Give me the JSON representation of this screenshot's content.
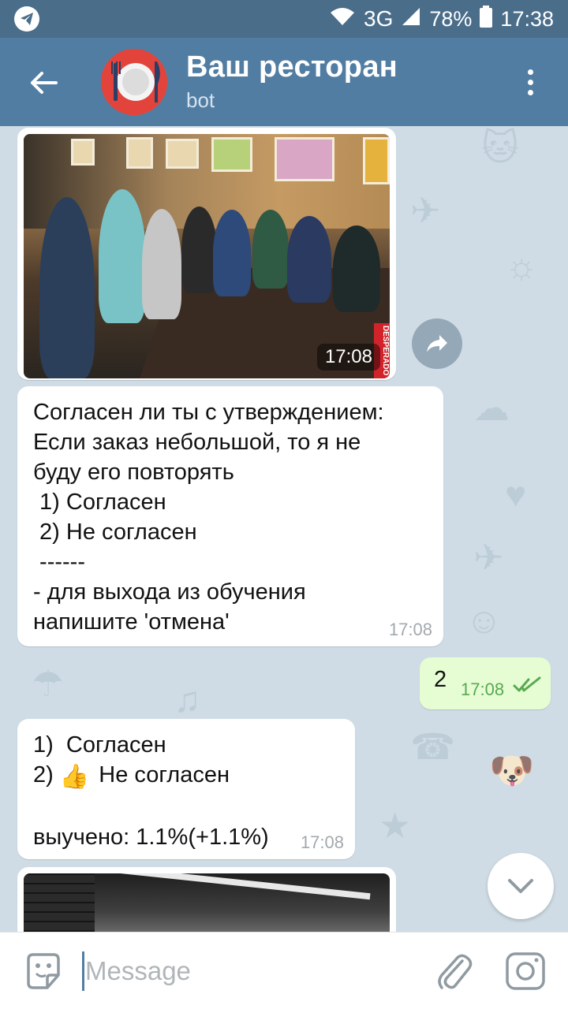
{
  "statusbar": {
    "network": "3G",
    "battery": "78%",
    "time": "17:38"
  },
  "header": {
    "title": "Ваш ресторан",
    "subtitle": "bot"
  },
  "messages": {
    "photo1": {
      "time": "17:08",
      "badge": "DESPERADO"
    },
    "question": {
      "lines": [
        "Согласен ли ты с утверждением:",
        "Если заказ небольшой, то я не",
        "буду его повторять",
        " 1) Согласен",
        " 2) Не согласен",
        " ------",
        "- для выхода из обучения",
        "напишите 'отмена'"
      ],
      "time": "17:08"
    },
    "outgoing": {
      "text": "2",
      "time": "17:08"
    },
    "result": {
      "line1": "1)  Согласен",
      "line2_prefix": "2) ",
      "line2_emoji": "👍",
      "line2_text": " Не согласен",
      "line3": "выучено: 1.1%(+1.1%)",
      "time": "17:08"
    }
  },
  "input": {
    "placeholder": "Message"
  },
  "icons": {
    "back": "arrow-left-icon",
    "menu": "more-vertical-icon",
    "forward": "share-forward-icon",
    "scroll": "chevron-down-icon",
    "emoji": "sticker-icon",
    "attach": "paperclip-icon",
    "camera": "camera-icon"
  },
  "colors": {
    "header": "#527da3",
    "statusbar": "#4a6d8a",
    "outgoing_bubble": "#e6fdd3",
    "chat_bg": "#cfdce5"
  }
}
